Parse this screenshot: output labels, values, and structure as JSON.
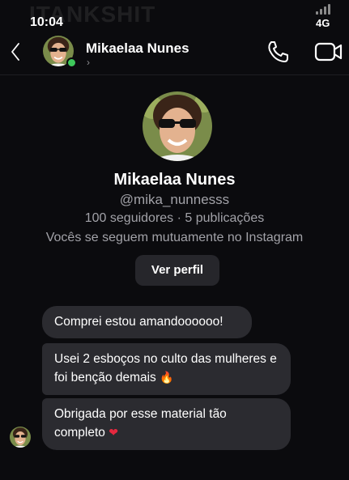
{
  "status_bar": {
    "time": "10:04",
    "network": "4G",
    "watermark": "ITANKSHIT"
  },
  "header": {
    "back_icon": "chevron-left-icon",
    "name": "Mikaelaa Nunes",
    "chevron": "›",
    "online": true,
    "call_icon": "phone-icon",
    "video_icon": "video-camera-icon"
  },
  "profile": {
    "name": "Mikaelaa Nunes",
    "handle": "@mika_nunnesss",
    "stats": "100 seguidores · 5 publicações",
    "mutual": "Vocês se seguem mutuamente no Instagram",
    "view_profile_label": "Ver perfil"
  },
  "messages": [
    {
      "text": "Comprei estou amandoooooo!",
      "emoji": ""
    },
    {
      "text": "Usei 2 esboços no culto das mulheres e foi benção demais",
      "emoji": "🔥"
    },
    {
      "text": "Obrigada por esse material tão completo",
      "emoji": "❤"
    }
  ],
  "colors": {
    "background": "#0b0b0e",
    "bubble": "#2b2b30",
    "secondary_text": "#a2a2a8",
    "online": "#3ec85b"
  }
}
